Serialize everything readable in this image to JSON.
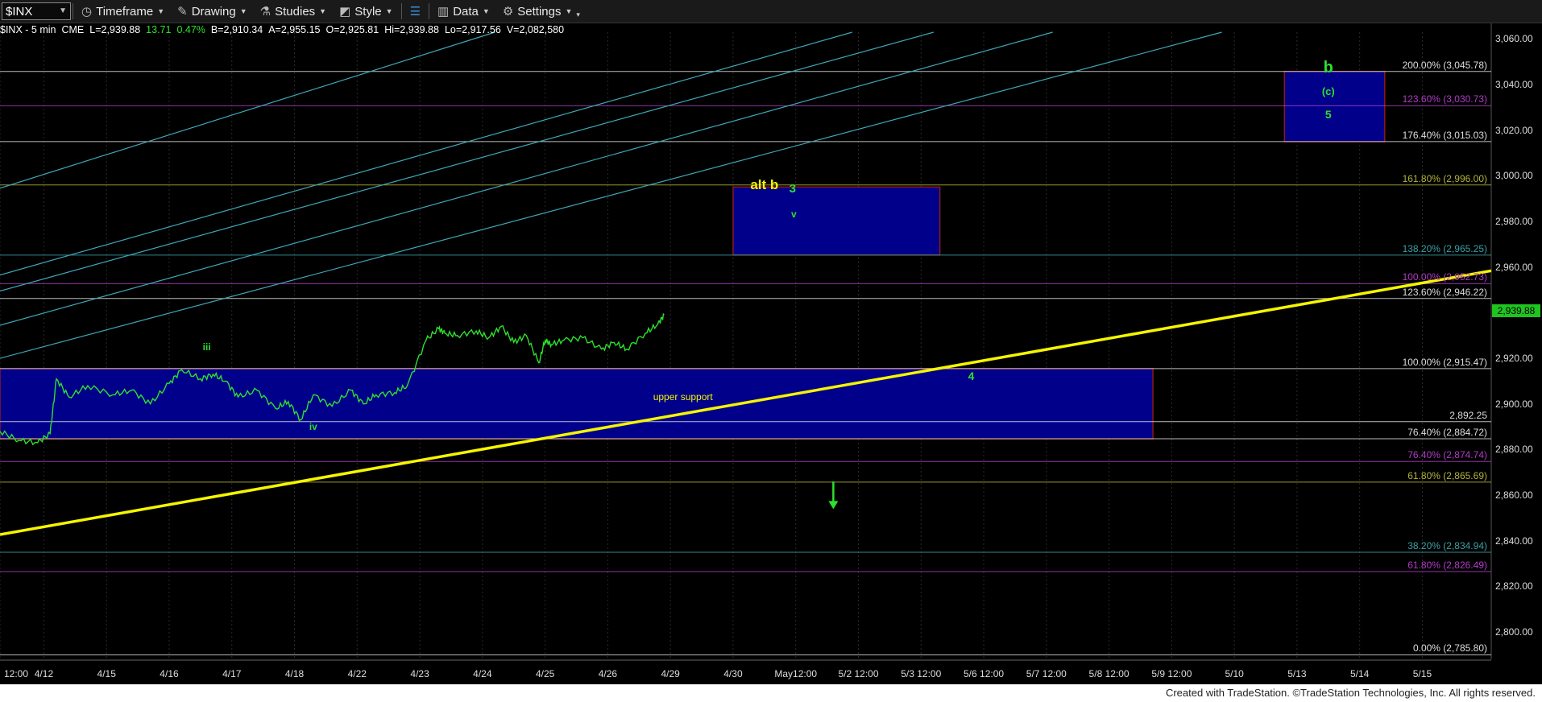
{
  "toolbar": {
    "symbol": "$INX",
    "timeframe": "Timeframe",
    "drawing": "Drawing",
    "studies": "Studies",
    "style": "Style",
    "data": "Data",
    "settings": "Settings"
  },
  "status": {
    "symbol": "$INX - 5 min",
    "exchange": "CME",
    "last": "L=2,939.88",
    "change": "13.71",
    "pct": "0.47%",
    "bid": "B=2,910.34",
    "ask": "A=2,955.15",
    "open": "O=2,925.81",
    "high": "Hi=2,939.88",
    "low": "Lo=2,917.56",
    "volume": "V=2,082,580"
  },
  "last_price": "2,939.88",
  "footer": "Created with TradeStation. ©TradeStation Technologies, Inc. All rights reserved.",
  "colors": {
    "price": "#2de02d",
    "trendline": "#f5f500",
    "channel": "#3fa6b8",
    "box_fill": "#00008b",
    "box_border": "#8b1a1a",
    "fib_white": "#dddddd",
    "fib_purple": "#b23ac8",
    "fib_olive": "#b3b33a",
    "fib_teal": "#3aa0a8"
  },
  "chart_data": {
    "type": "line",
    "title": "$INX - 5 min",
    "y_ticks": [
      "3,060.00",
      "3,040.00",
      "3,020.00",
      "3,000.00",
      "2,980.00",
      "2,960.00",
      "2,940.00",
      "2,920.00",
      "2,900.00",
      "2,880.00",
      "2,860.00",
      "2,840.00",
      "2,820.00",
      "2,800.00"
    ],
    "y_tick_values": [
      3060,
      3040,
      3020,
      3000,
      2980,
      2960,
      2940,
      2920,
      2900,
      2880,
      2860,
      2840,
      2820,
      2800
    ],
    "ylim": [
      2788,
      3063
    ],
    "x_ticks": [
      "12:00",
      "4/12",
      "4/15",
      "4/16",
      "4/17",
      "4/18",
      "4/22",
      "4/23",
      "4/24",
      "4/25",
      "4/26",
      "4/29",
      "4/30",
      "May12:00",
      "5/2 12:00",
      "5/3 12:00",
      "5/6 12:00",
      "5/7 12:00",
      "5/8 12:00",
      "5/9 12:00",
      "5/10",
      "5/13",
      "5/14",
      "5/15"
    ],
    "x_tick_units": [
      0.0,
      0.7,
      1.7,
      2.7,
      3.7,
      4.7,
      5.7,
      6.7,
      7.7,
      8.7,
      9.7,
      10.7,
      11.7,
      12.7,
      13.7,
      14.7,
      15.7,
      16.7,
      17.7,
      18.7,
      19.7,
      20.7,
      21.7,
      22.7
    ],
    "xlim": [
      0,
      23.8
    ],
    "price_series": {
      "name": "$INX",
      "x": [
        0.0,
        0.3,
        0.6,
        0.8,
        0.9,
        1.1,
        1.4,
        1.8,
        2.1,
        2.4,
        2.7,
        2.9,
        3.2,
        3.4,
        3.6,
        3.8,
        4.1,
        4.4,
        4.6,
        4.8,
        5.0,
        5.3,
        5.6,
        5.8,
        6.0,
        6.3,
        6.5,
        6.8,
        7.0,
        7.1,
        7.3,
        7.6,
        7.8,
        8.0,
        8.2,
        8.4,
        8.6,
        8.7,
        8.8,
        9.0,
        9.3,
        9.6,
        9.8,
        10.0,
        10.3,
        10.5,
        10.6
      ],
      "y": [
        2888,
        2884,
        2883,
        2887,
        2911,
        2903,
        2908,
        2904,
        2906,
        2900,
        2909,
        2915,
        2911,
        2913,
        2910,
        2903,
        2906,
        2898,
        2901,
        2893,
        2904,
        2899,
        2906,
        2900,
        2904,
        2905,
        2908,
        2928,
        2933,
        2931,
        2930,
        2932,
        2929,
        2934,
        2927,
        2930,
        2918,
        2928,
        2926,
        2928,
        2929,
        2924,
        2927,
        2924,
        2931,
        2935,
        2939
      ]
    },
    "trendline": {
      "x": [
        0.0,
        23.8
      ],
      "y": [
        2842.7,
        2958.4
      ]
    },
    "channel_lines": [
      {
        "x": [
          0.0,
          7.9
        ],
        "y": [
          2994.6,
          3063
        ]
      },
      {
        "x": [
          0.0,
          13.6
        ],
        "y": [
          2956.5,
          3063
        ]
      },
      {
        "x": [
          0.0,
          14.9
        ],
        "y": [
          2949.5,
          3063
        ]
      },
      {
        "x": [
          0.0,
          16.8
        ],
        "y": [
          2934.5,
          3063
        ]
      },
      {
        "x": [
          0.0,
          19.5
        ],
        "y": [
          2920.0,
          3063
        ]
      }
    ],
    "fib_levels": [
      {
        "label": "200.00% (3,045.78)",
        "value": 3045.78,
        "color": "fib_white"
      },
      {
        "label": "123.60% (3,030.73)",
        "value": 3030.73,
        "color": "fib_purple"
      },
      {
        "label": "176.40% (3,015.03)",
        "value": 3015.03,
        "color": "fib_white"
      },
      {
        "label": "161.80% (2,996.00)",
        "value": 2996.0,
        "color": "fib_olive"
      },
      {
        "label": "138.20% (2,965.25)",
        "value": 2965.25,
        "color": "fib_teal"
      },
      {
        "label": "100.00% (2,952.73)",
        "value": 2952.73,
        "color": "fib_purple"
      },
      {
        "label": "123.60% (2,946.22)",
        "value": 2946.22,
        "color": "fib_white"
      },
      {
        "label": "100.00% (2,915.47)",
        "value": 2915.47,
        "color": "fib_white"
      },
      {
        "label": "2,892.25",
        "value": 2892.25,
        "color": "fib_white"
      },
      {
        "label": "76.40% (2,884.72)",
        "value": 2884.72,
        "color": "fib_white"
      },
      {
        "label": "76.40% (2,874.74)",
        "value": 2874.74,
        "color": "fib_purple"
      },
      {
        "label": "61.80% (2,865.69)",
        "value": 2865.69,
        "color": "fib_olive"
      },
      {
        "label": "38.20% (2,834.94)",
        "value": 2834.94,
        "color": "fib_teal"
      },
      {
        "label": "61.80% (2,826.49)",
        "value": 2826.49,
        "color": "fib_purple"
      },
      {
        "label": "0.00% (2,785.80)",
        "value": 2790.0,
        "color": "fib_white"
      }
    ],
    "boxes": [
      {
        "name": "upper support",
        "x": [
          0.0,
          18.4
        ],
        "y": [
          2884.7,
          2915.5
        ]
      },
      {
        "name": "alt b target",
        "x": [
          11.7,
          15.0
        ],
        "y": [
          2965.3,
          2995.1
        ]
      },
      {
        "name": "b target",
        "x": [
          20.5,
          22.1
        ],
        "y": [
          3015.0,
          3045.8
        ]
      }
    ],
    "annotations": [
      {
        "text": "alt b",
        "x": 12.2,
        "y": 2996,
        "color": "#f5f500",
        "size": 17
      },
      {
        "text": "3",
        "x": 12.65,
        "y": 2994,
        "color": "#2de02d",
        "size": 15
      },
      {
        "text": "v",
        "x": 12.67,
        "y": 2983,
        "color": "#2de02d",
        "size": 12
      },
      {
        "text": "b",
        "x": 21.2,
        "y": 3047,
        "color": "#2de02d",
        "size": 20
      },
      {
        "text": "(c)",
        "x": 21.2,
        "y": 3037,
        "color": "#2de02d",
        "size": 13
      },
      {
        "text": "5",
        "x": 21.2,
        "y": 3027,
        "color": "#2de02d",
        "size": 14
      },
      {
        "text": "upper support",
        "x": 10.9,
        "y": 2903,
        "color": "#f5f500",
        "size": 12
      },
      {
        "text": "4",
        "x": 15.5,
        "y": 2912,
        "color": "#2de02d",
        "size": 14
      },
      {
        "text": "iii",
        "x": 3.3,
        "y": 2925,
        "color": "#2de02d",
        "size": 12
      },
      {
        "text": "iv",
        "x": 5.0,
        "y": 2890,
        "color": "#2de02d",
        "size": 12
      }
    ],
    "down_arrow": {
      "x": 13.3,
      "y_from": 2866,
      "y_to": 2856
    }
  }
}
